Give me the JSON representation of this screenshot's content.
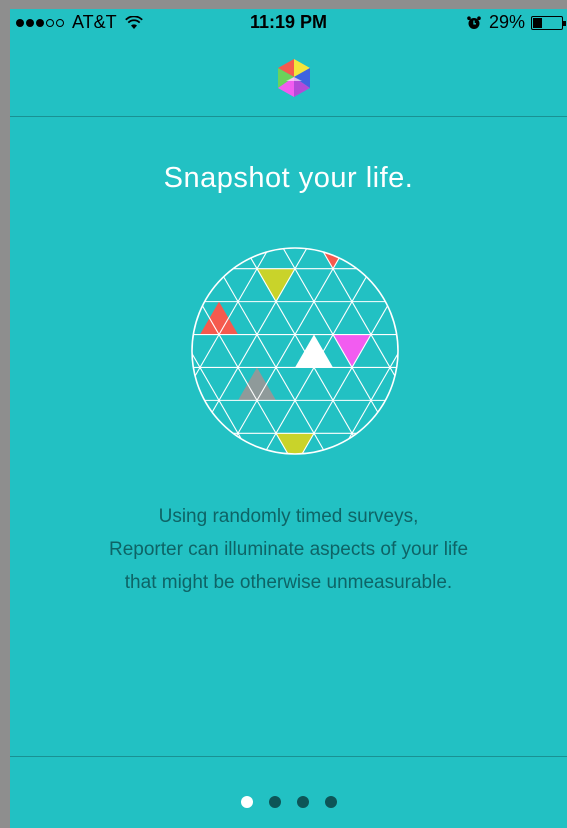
{
  "status_bar": {
    "carrier": "AT&T",
    "time": "11:19 PM",
    "battery_percent": "29%",
    "battery_level": 0.29,
    "signal_bars_filled": 3,
    "signal_bars_total": 5,
    "icons": [
      "wifi-icon",
      "alarm-icon",
      "battery-icon"
    ]
  },
  "header": {
    "logo_icon": "app-logo-icon"
  },
  "onboarding": {
    "title": "Snapshot your life.",
    "hero_icon": "triangle-globe-icon",
    "description_lines": [
      "Using randomly timed surveys,",
      "Reporter can illuminate aspects of your life",
      "that might be otherwise unmeasurable."
    ]
  },
  "pagination": {
    "current": 1,
    "total": 4
  },
  "colors": {
    "background": "#22c1c3",
    "title_text": "#ffffff",
    "body_text": "#0e6466",
    "dot_active": "#ffffff",
    "dot_inactive": "#0d5557",
    "accent_red": "#f55a4e",
    "accent_yellow": "#c9d32a",
    "accent_magenta": "#f25cf0",
    "accent_gray": "#8f9a9a"
  }
}
